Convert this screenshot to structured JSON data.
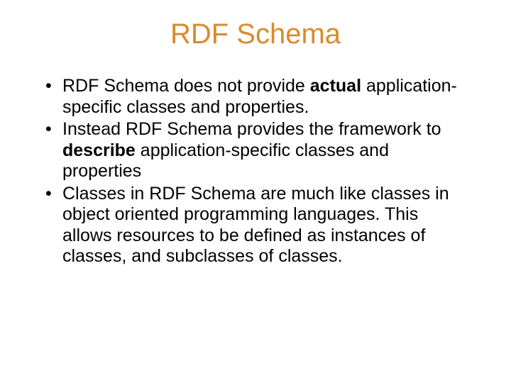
{
  "slide": {
    "title": "RDF Schema",
    "bullets": [
      {
        "pre": "RDF Schema does not provide ",
        "bold": "actual",
        "post": " application-specific classes and properties."
      },
      {
        "pre": "Instead RDF Schema provides the framework to ",
        "bold": "describe",
        "post": " application-specific classes and properties"
      },
      {
        "pre": "Classes in RDF Schema are much like classes in object oriented programming languages. This allows resources to be defined as instances of classes, and subclasses of classes.",
        "bold": "",
        "post": ""
      }
    ]
  }
}
